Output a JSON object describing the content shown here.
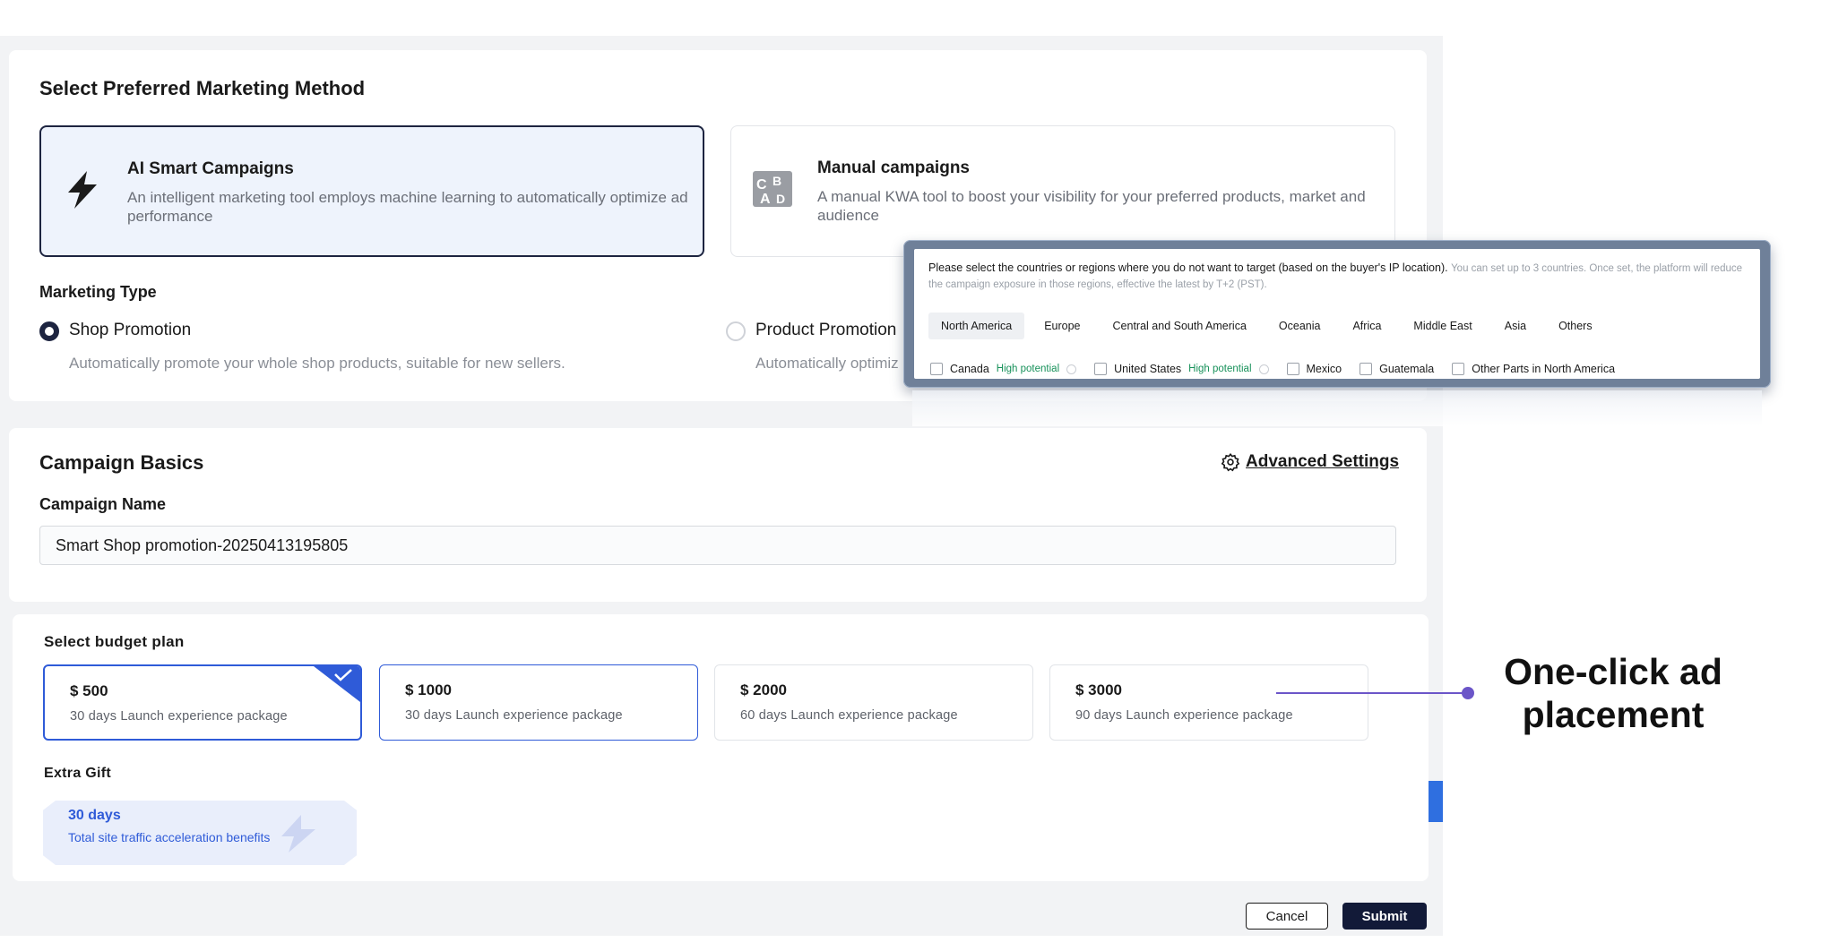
{
  "method": {
    "title": "Select Preferred Marketing Method",
    "options": [
      {
        "title": "AI Smart Campaigns",
        "desc": "An intelligent marketing tool employs machine learning to automatically optimize ad performance",
        "icon": "lightning-bolt-icon",
        "selected": true
      },
      {
        "title": "Manual campaigns",
        "desc": "A manual KWA tool to boost your visibility for your preferred products, market and audience",
        "icon": "abc-letters-icon",
        "selected": false
      }
    ],
    "type_label": "Marketing Type",
    "types": [
      {
        "label": "Shop Promotion",
        "desc": "Automatically promote your whole shop products, suitable for new sellers.",
        "checked": true
      },
      {
        "label": "Product Promotion",
        "desc": "Automatically optimiz",
        "checked": false
      }
    ]
  },
  "basics": {
    "title": "Campaign Basics",
    "advanced_settings": "Advanced Settings",
    "name_label": "Campaign Name",
    "name_value": "Smart Shop promotion-20250413195805"
  },
  "budget": {
    "title": "Select budget plan",
    "plans": [
      {
        "price": "$ 500",
        "desc": "30 days Launch experience package",
        "selected": true
      },
      {
        "price": "$ 1000",
        "desc": "30 days Launch experience package",
        "selected": false
      },
      {
        "price": "$ 2000",
        "desc": "60 days Launch experience package",
        "selected": false
      },
      {
        "price": "$ 3000",
        "desc": "90 days Launch experience package",
        "selected": false
      }
    ],
    "gift_label": "Extra Gift",
    "gift": {
      "days": "30 days",
      "desc": "Total site traffic acceleration benefits"
    }
  },
  "actions": {
    "cancel": "Cancel",
    "submit": "Submit"
  },
  "overlay": {
    "heading": "Please select the countries or regions where you do not want to target (based on the buyer's IP location).",
    "note": "You can set up to 3 countries. Once set, the platform will reduce the campaign exposure in those regions, effective the latest by T+2 (PST).",
    "tabs": [
      "North America",
      "Europe",
      "Central and South America",
      "Oceania",
      "Africa",
      "Middle East",
      "Asia",
      "Others"
    ],
    "options": [
      {
        "label": "Canada",
        "tag": "High potential"
      },
      {
        "label": "United States",
        "tag": "High potential"
      },
      {
        "label": "Mexico",
        "tag": ""
      },
      {
        "label": "Guatemala",
        "tag": ""
      },
      {
        "label": "Other Parts in North America",
        "tag": ""
      }
    ]
  },
  "annotation": {
    "line1": "One-click ad",
    "line2": "placement"
  },
  "colors": {
    "accent": "#2f5bd8",
    "dark": "#121a38",
    "success": "#17915a",
    "callout": "#6b55c8"
  }
}
